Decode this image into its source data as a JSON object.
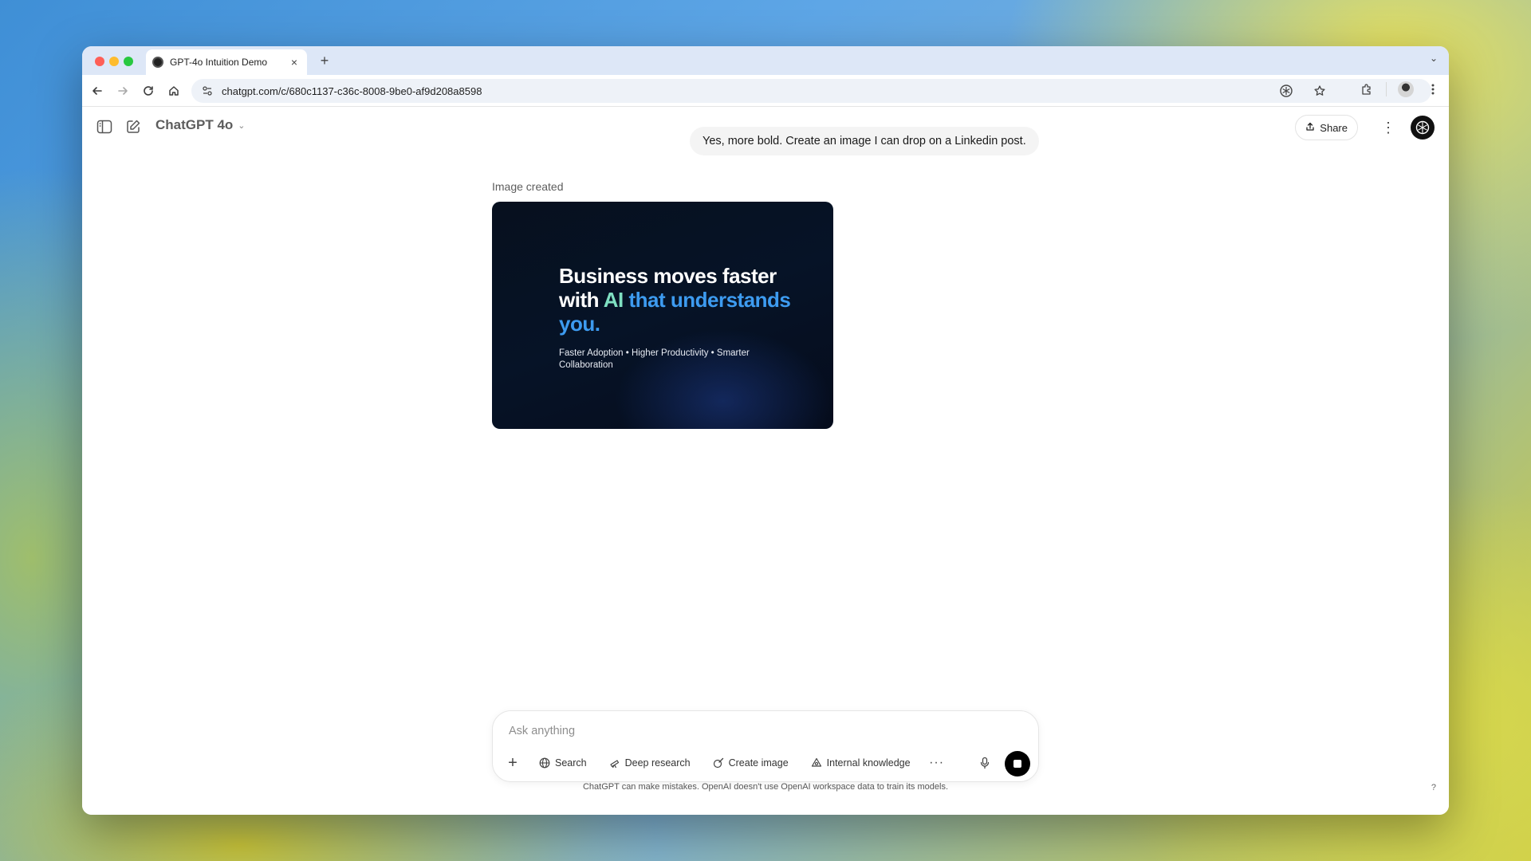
{
  "browser": {
    "tab": {
      "title": "GPT-4o Intuition Demo",
      "close": "×"
    },
    "new_tab": "+",
    "tab_dropdown": "⌄",
    "url": "chatgpt.com/c/680c1137-c36c-8008-9be0-af9d208a8598"
  },
  "header": {
    "model_name": "ChatGPT 4o",
    "model_chevron": "⌄",
    "share_label": "Share",
    "more": "⋮"
  },
  "conversation": {
    "user_message": "Yes, more bold. Create an image I can drop on a Linkedin post.",
    "assistant_label": "Image created",
    "image": {
      "headline_part1": "Business moves faster with ",
      "headline_ai": "AI",
      "headline_part2": " that understands you.",
      "subtitle": "Faster Adoption • Higher Productivity • Smarter Collaboration"
    }
  },
  "composer": {
    "placeholder": "Ask anything",
    "plus": "+",
    "tools": [
      {
        "label": "Search",
        "icon": "globe-icon"
      },
      {
        "label": "Deep research",
        "icon": "telescope-icon"
      },
      {
        "label": "Create image",
        "icon": "image-brush-icon"
      },
      {
        "label": "Internal knowledge",
        "icon": "knowledge-icon"
      }
    ],
    "more": "···"
  },
  "footer": {
    "disclaimer": "ChatGPT can make mistakes. OpenAI doesn't use OpenAI workspace data to train its models.",
    "help": "?"
  },
  "colors": {
    "accent_ai": "#7fe0c2",
    "accent_blue": "#3d9bf0",
    "image_bg": "#061327"
  }
}
